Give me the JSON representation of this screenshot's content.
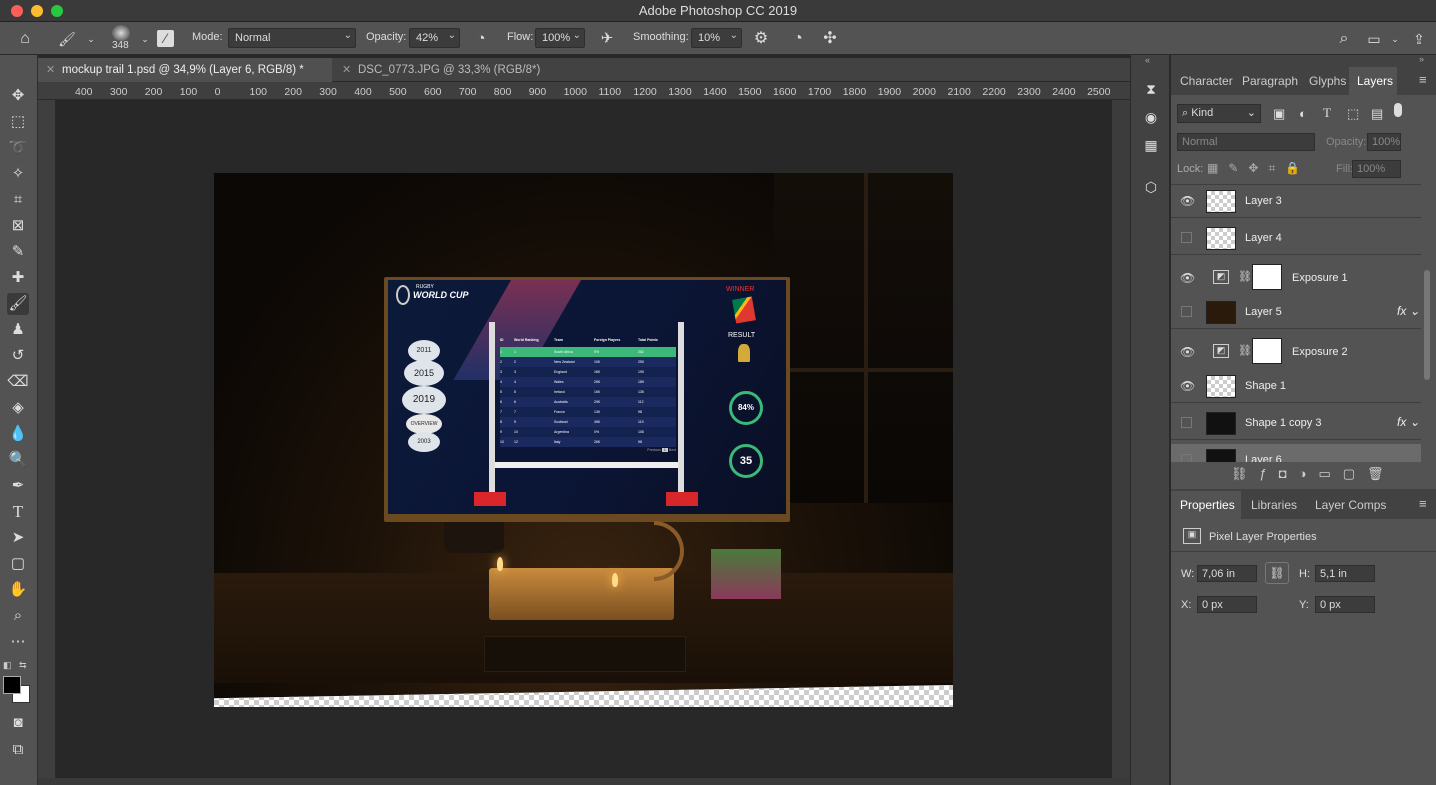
{
  "app": {
    "title": "Adobe Photoshop CC 2019"
  },
  "options": {
    "brush_size": "348",
    "mode_label": "Mode:",
    "mode_value": "Normal",
    "opacity_label": "Opacity:",
    "opacity_value": "42%",
    "flow_label": "Flow:",
    "flow_value": "100%",
    "smoothing_label": "Smoothing:",
    "smoothing_value": "10%"
  },
  "tabs": [
    {
      "label": "mockup trail 1.psd @ 34,9% (Layer 6, RGB/8) *"
    },
    {
      "label": "DSC_0773.JPG @ 33,3% (RGB/8*)"
    }
  ],
  "ruler": {
    "h_ticks": [
      "400",
      "300",
      "200",
      "100",
      "0",
      "100",
      "200",
      "300",
      "400",
      "500",
      "600",
      "700",
      "800",
      "900",
      "1000",
      "1100",
      "1200",
      "1300",
      "1400",
      "1500",
      "1600",
      "1700",
      "1800",
      "1900",
      "2000",
      "2100",
      "2200",
      "2300",
      "2400",
      "2500"
    ]
  },
  "layers_panel": {
    "tabs": [
      "Character",
      "Paragraph",
      "Glyphs",
      "Layers"
    ],
    "active_tab": "Layers",
    "filter_kind": "Kind",
    "blend_mode": "Normal",
    "opacity_label": "Opacity:",
    "opacity_value": "100%",
    "lock_label": "Lock:",
    "fill_label": "Fill:",
    "fill_value": "100%",
    "layers": [
      {
        "name": "Layer 3",
        "visible": true,
        "fx": false
      },
      {
        "name": "Layer 4",
        "visible": false,
        "fx": false
      },
      {
        "name": "Exposure 1",
        "visible": true,
        "fx": false,
        "adjustment": true
      },
      {
        "name": "Layer 5",
        "visible": false,
        "fx": true
      },
      {
        "name": "Exposure 2",
        "visible": true,
        "fx": false,
        "adjustment": true
      },
      {
        "name": "Shape 1",
        "visible": true,
        "fx": false
      },
      {
        "name": "Shape 1 copy 3",
        "visible": false,
        "fx": true
      },
      {
        "name": "Layer 6",
        "visible": false,
        "fx": false,
        "selected": true
      }
    ]
  },
  "properties_panel": {
    "tabs": [
      "Properties",
      "Libraries",
      "Layer Comps"
    ],
    "active_tab": "Properties",
    "header": "Pixel Layer Properties",
    "w_label": "W:",
    "w_value": "7,06 in",
    "h_label": "H:",
    "h_value": "5,1 in",
    "x_label": "X:",
    "x_value": "0 px",
    "y_label": "Y:",
    "y_value": "0 px"
  },
  "document": {
    "logo_top": "RUGBY",
    "logo_main": "WORLD CUP",
    "winner": "WINNER",
    "result": "RESULT",
    "percent": "84%",
    "score": "35",
    "years": [
      "2011",
      "2015",
      "2019",
      "OVERVIEW",
      "2003"
    ],
    "table_headers": [
      "ID",
      "World Ranking",
      "Team",
      "Foreign Players",
      "Total Points"
    ],
    "table_rows": [
      [
        "1",
        "1",
        "South Africa",
        "0%",
        "262"
      ],
      [
        "2",
        "2",
        "New Zealand",
        "10K",
        "250"
      ],
      [
        "3",
        "3",
        "England",
        "18K",
        "190"
      ],
      [
        "4",
        "4",
        "Wales",
        "25K",
        "189"
      ],
      [
        "5",
        "5",
        "Ireland",
        "16K",
        "135"
      ],
      [
        "6",
        "6",
        "Australia",
        "29K",
        "112"
      ],
      [
        "7",
        "7",
        "France",
        "13K",
        "98"
      ],
      [
        "8",
        "9",
        "Scotland",
        "45K",
        "119"
      ],
      [
        "9",
        "10",
        "Argentina",
        "0%",
        "106"
      ],
      [
        "10",
        "12",
        "Italy",
        "26K",
        "98"
      ]
    ],
    "pager_prev": "Previous",
    "pager_page": "1",
    "pager_next": "Next"
  },
  "colors": {
    "accent_green": "#3cb878",
    "red": "#d9262a",
    "panel": "#535353"
  }
}
